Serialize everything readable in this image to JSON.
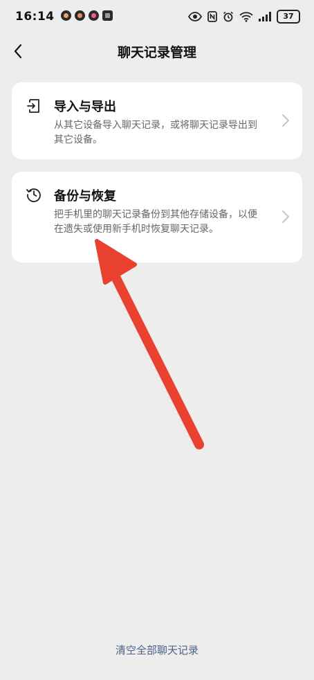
{
  "status_bar": {
    "time": "16:14",
    "battery": "37",
    "app_icons": [
      "app-icon",
      "app-icon",
      "app-icon",
      "app-icon"
    ],
    "system_icons": [
      "eye-icon",
      "nfc-icon",
      "alarm-icon",
      "wifi-icon",
      "signal-icon",
      "battery-icon"
    ]
  },
  "header": {
    "title": "聊天记录管理",
    "back_icon": "chevron-left-icon"
  },
  "cards": [
    {
      "icon": "import-export-icon",
      "title": "导入与导出",
      "description": "从其它设备导入聊天记录，或将聊天记录导出到其它设备。"
    },
    {
      "icon": "history-icon",
      "title": "备份与恢复",
      "description": "把手机里的聊天记录备份到其他存储设备，以便在遗失或使用新手机时恢复聊天记录。"
    }
  ],
  "footer": {
    "clear_label": "清空全部聊天记录"
  },
  "colors": {
    "background": "#ededed",
    "card": "#ffffff",
    "link": "#4a6487",
    "annotation": "#e8412f"
  }
}
